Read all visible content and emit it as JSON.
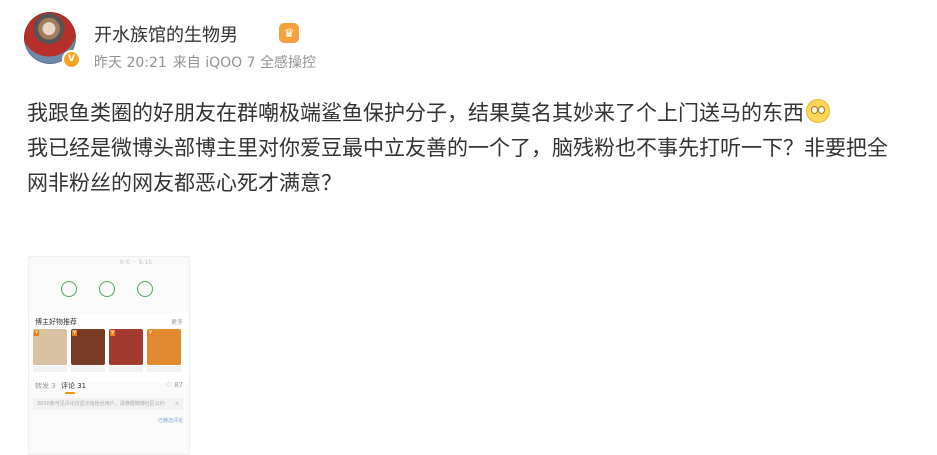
{
  "post": {
    "author": {
      "name": "开水族馆的生物男",
      "verified_badge": "V",
      "member_icon": "crown-icon",
      "accent_color": "#f4a23c"
    },
    "meta": {
      "time": "昨天 20:21",
      "source": "来自 iQOO 7 全感操控"
    },
    "text": {
      "line1": "我跟鱼类圈的好朋友在群嘲极端鲨鱼保护分子，结果莫名其妙来了个上门送马的东西",
      "line2": "我已经是微博头部博主里对你爱豆最中立友善的一个了，脑残粉也不事先打听一下？非要把全网非粉丝的网友都恶心死才满意？",
      "emoji": "dizzy-face-emoji"
    },
    "attached_screenshot": {
      "status_text": "©© ·· 5:15",
      "section_title": "博主好物推荐",
      "section_more": "更多",
      "products": [
        {
          "tag": "¥",
          "color": "#d9c1a3"
        },
        {
          "tag": "¥",
          "color": "#7a3b26"
        },
        {
          "tag": "¥",
          "color": "#a23a30"
        },
        {
          "tag": "¥",
          "color": "#e28a2f"
        }
      ],
      "tabs": [
        {
          "label": "转发 3"
        },
        {
          "label": "评论 31"
        }
      ],
      "likes": "♡ 87",
      "notice": "3030条可见评论仅显示给粉丝用户，请遵循微博社区公约",
      "notice_close": "×",
      "bottom_link": "已精选评论"
    }
  }
}
